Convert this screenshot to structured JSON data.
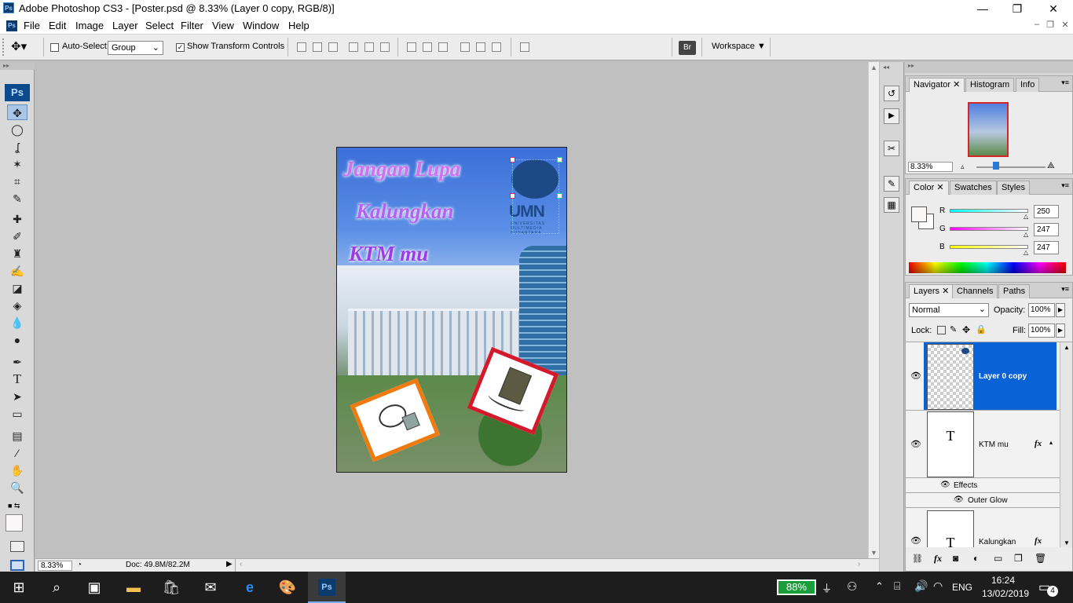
{
  "window": {
    "title": "Adobe Photoshop CS3 - [Poster.psd @ 8.33% (Layer 0 copy, RGB/8)]",
    "app_badge": "Ps",
    "minimize": "—",
    "maximize": "❐",
    "close": "✕"
  },
  "menu": [
    "File",
    "Edit",
    "Image",
    "Layer",
    "Select",
    "Filter",
    "View",
    "Window",
    "Help"
  ],
  "options": {
    "auto_select_label": "Auto-Select:",
    "auto_select_value": "Group",
    "show_transform_label": "Show Transform Controls",
    "workspace_label": "Workspace ▼"
  },
  "toolbox_badge": "Ps",
  "poster": {
    "line1": "Jangan Lupa",
    "line2": "Kalungkan",
    "line3": "KTM mu",
    "logo_text": "UMN",
    "logo_sub": "UNIVERSITAS MULTIMEDIA NUSANTARA"
  },
  "status": {
    "zoom": "8.33%",
    "doc": "Doc: 49.8M/82.2M"
  },
  "navigator": {
    "tabs": [
      "Navigator",
      "Histogram",
      "Info"
    ],
    "zoom": "8.33%"
  },
  "color": {
    "tabs": [
      "Color",
      "Swatches",
      "Styles"
    ],
    "r_label": "R",
    "g_label": "G",
    "b_label": "B",
    "r": "250",
    "g": "247",
    "b": "247"
  },
  "layers": {
    "tabs": [
      "Layers",
      "Channels",
      "Paths"
    ],
    "blend": "Normal",
    "opacity_label": "Opacity:",
    "opacity": "100%",
    "lock_label": "Lock:",
    "fill_label": "Fill:",
    "fill": "100%",
    "items": [
      {
        "name": "Layer 0 copy"
      },
      {
        "name": "KTM mu",
        "effects": "Effects",
        "effect": "Outer Glow"
      },
      {
        "name": "Kalungkan"
      }
    ],
    "text_thumb": "T",
    "fx": "fx"
  },
  "taskbar": {
    "battery": "88%",
    "lang": "ENG",
    "time": "16:24",
    "date": "13/02/2019",
    "notif": "4"
  }
}
